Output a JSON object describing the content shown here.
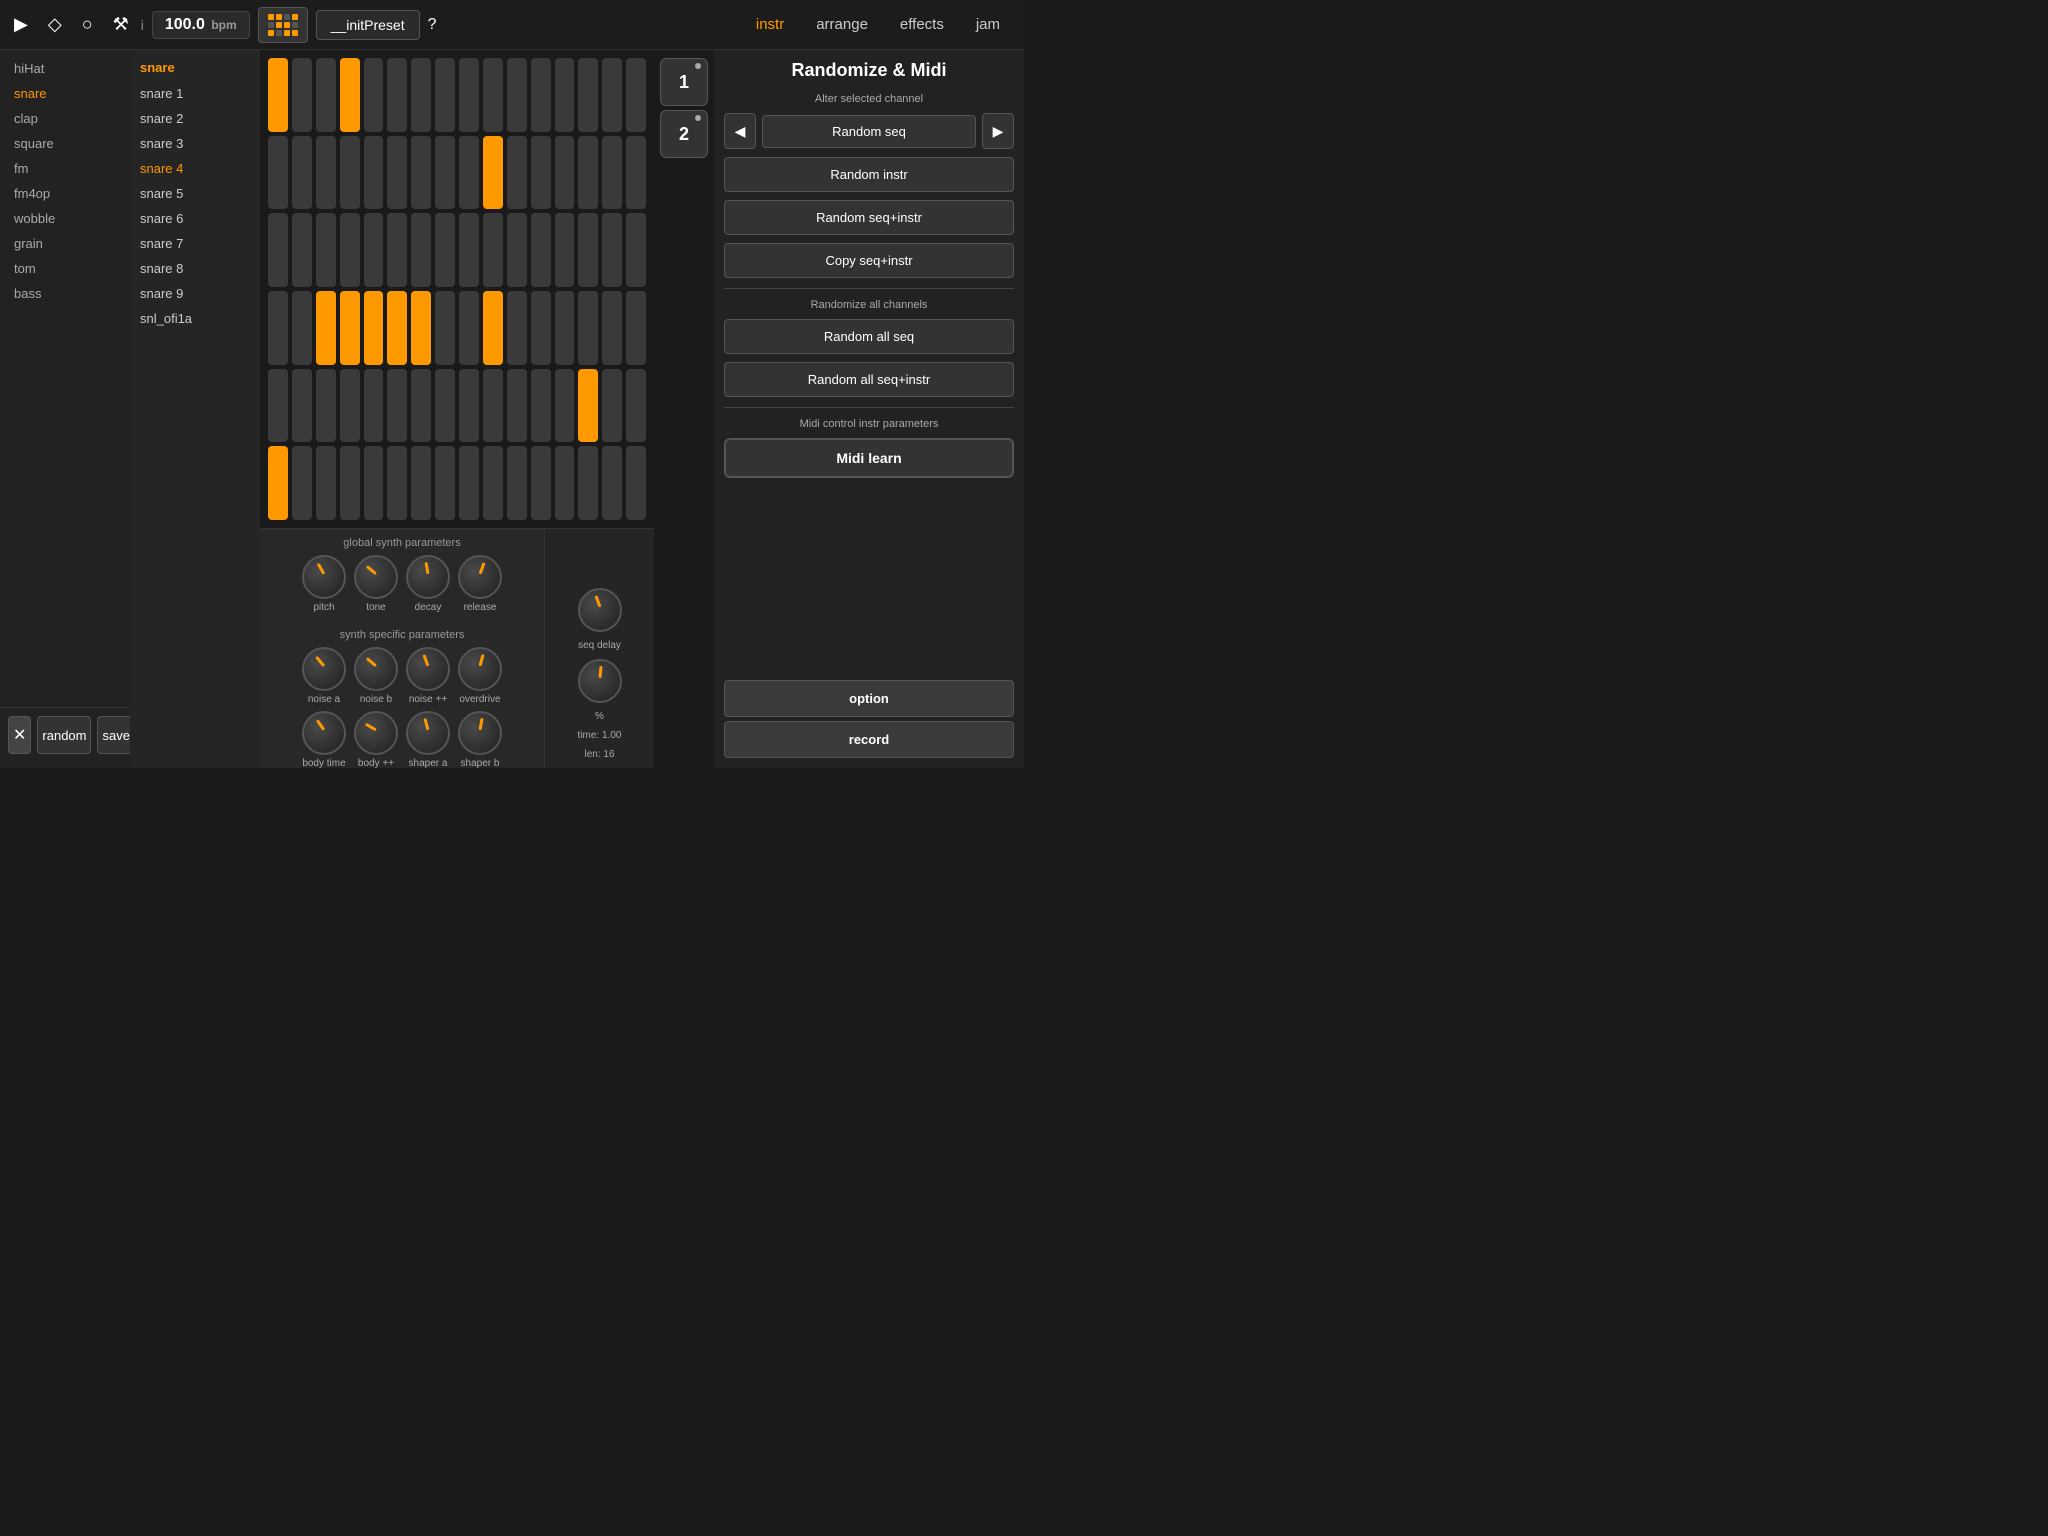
{
  "topbar": {
    "bpm": "100.0",
    "bpm_unit": "bpm",
    "preset": "__initPreset",
    "help": "?",
    "info": "i",
    "tabs": [
      "instr",
      "arrange",
      "effects",
      "jam"
    ],
    "active_tab": "instr"
  },
  "sidebar": {
    "instruments": [
      "hiHat",
      "snare",
      "clap",
      "square",
      "fm",
      "fm4op",
      "wobble",
      "grain",
      "tom",
      "bass"
    ],
    "active": "snare"
  },
  "sub_list": {
    "title": "snare",
    "items": [
      "snare 1",
      "snare 2",
      "snare 3",
      "snare 4",
      "snare 5",
      "snare 6",
      "snare 7",
      "snare 8",
      "snare 9",
      "snl_ofi1a"
    ],
    "active": "snare 4"
  },
  "bottom_buttons": {
    "close": "✕",
    "random": "random",
    "save": "save"
  },
  "sequencer": {
    "rows": 6,
    "cols": 16,
    "active_pads": [
      [
        0,
        0
      ],
      [
        0,
        3
      ],
      [
        1,
        9
      ],
      [
        3,
        2
      ],
      [
        3,
        3
      ],
      [
        3,
        4
      ],
      [
        3,
        5
      ],
      [
        3,
        6
      ],
      [
        3,
        9
      ],
      [
        4,
        13
      ],
      [
        5,
        0
      ]
    ]
  },
  "track_nums": [
    {
      "label": "1"
    },
    {
      "label": "2"
    }
  ],
  "synth": {
    "global_label": "global synth parameters",
    "specific_label": "synth specific parameters",
    "global_knobs": [
      {
        "id": "pitch",
        "label": "pitch",
        "rotation": -30
      },
      {
        "id": "tone",
        "label": "tone",
        "rotation": -50
      },
      {
        "id": "decay",
        "label": "decay",
        "rotation": -10
      },
      {
        "id": "release",
        "label": "release",
        "rotation": 20
      }
    ],
    "specific_knobs": [
      {
        "id": "noise-a",
        "label": "noise a",
        "rotation": -40
      },
      {
        "id": "noise-b",
        "label": "noise b",
        "rotation": -50
      },
      {
        "id": "noise-pp",
        "label": "noise ++",
        "rotation": -20
      },
      {
        "id": "overdrive",
        "label": "overdrive",
        "rotation": 15
      }
    ],
    "body_knobs": [
      {
        "id": "body-time",
        "label": "body time",
        "rotation": -35
      },
      {
        "id": "body-pp",
        "label": "body ++",
        "rotation": -60
      },
      {
        "id": "shaper-a",
        "label": "shaper a",
        "rotation": -15
      },
      {
        "id": "shaper-b",
        "label": "shaper b",
        "rotation": 10
      }
    ]
  },
  "extra": {
    "time_label": "time: 1.00",
    "len_label": "len: 16"
  },
  "right_panel": {
    "title": "Randomize & Midi",
    "subtitle": "Alter selected channel",
    "random_seq": "Random seq",
    "random_instr": "Random instr",
    "random_seq_instr": "Random seq+instr",
    "copy_seq_instr": "Copy seq+instr",
    "randomize_all_label": "Randomize all channels",
    "random_all_seq": "Random all seq",
    "random_all_seq_instr": "Random all seq+instr",
    "midi_label": "Midi control instr parameters",
    "midi_learn": "Midi learn",
    "option": "option",
    "record": "record"
  },
  "colors": {
    "accent": "#f90",
    "bg_dark": "#1a1a1a",
    "bg_panel": "#2a2a2a",
    "active_pad": "#f90"
  }
}
